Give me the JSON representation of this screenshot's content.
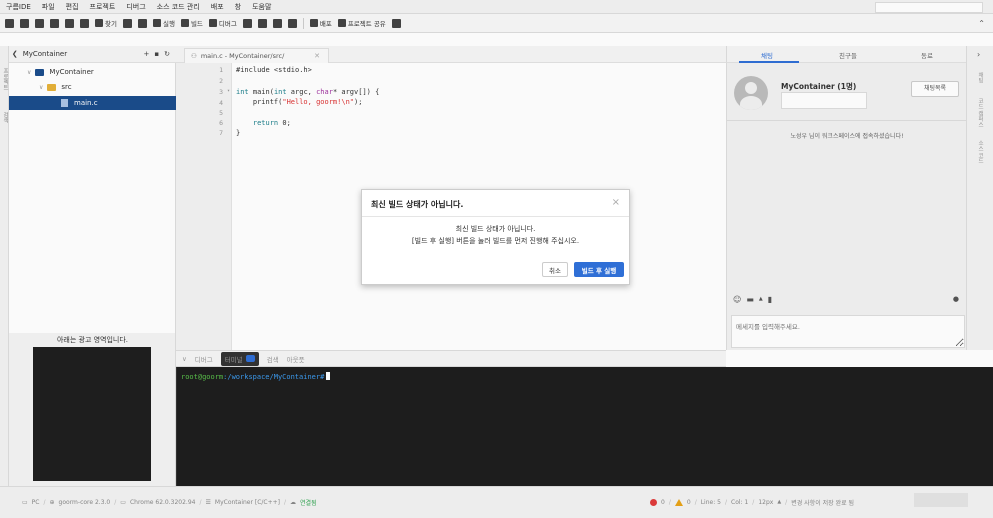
{
  "menubar": {
    "items": [
      "구름IDE",
      "파일",
      "편집",
      "프로젝트",
      "디버그",
      "소스 코드 관리",
      "배포",
      "창",
      "도움말"
    ]
  },
  "toolbar": {
    "find_label": "찾기",
    "run_label": "실행",
    "build_label": "빌드",
    "debug_label": "디버그",
    "deploy_label": "배포",
    "share_label": "프로젝트 공유"
  },
  "left_strip": {
    "labels": [
      "프로젝트",
      "검색"
    ]
  },
  "tree": {
    "header": "MyContainer",
    "items": [
      {
        "label": "MyContainer",
        "kind": "project"
      },
      {
        "label": "src",
        "kind": "folder"
      },
      {
        "label": "main.c",
        "kind": "file",
        "selected": true
      }
    ]
  },
  "ad": {
    "label": "아래는 광고 영역입니다."
  },
  "editor": {
    "tab_label": "main.c - MyContainer/src/",
    "lines": [
      {
        "n": "1",
        "text": "#include <stdio.h>"
      },
      {
        "n": "2",
        "text": ""
      },
      {
        "n": "3",
        "text": "int main(int argc, char* argv[]) {"
      },
      {
        "n": "4",
        "text": "    printf(\"Hello, goorm!\\n\");"
      },
      {
        "n": "5",
        "text": ""
      },
      {
        "n": "6",
        "text": "    return 0;"
      },
      {
        "n": "7",
        "text": "}"
      }
    ],
    "line3": {
      "kw": "int ",
      "fn": "main(",
      "kw2": "int ",
      "mid": "argc, ",
      "ty": "char",
      "rest": "* argv[]) {"
    },
    "line4": {
      "pre": "    printf(",
      "str": "\"Hello, goorm!\\n\"",
      "post": ");"
    },
    "line6": {
      "kw": "    return ",
      "rest": "0;"
    }
  },
  "terminal": {
    "tabs": [
      "디버그",
      "터미널",
      "검색",
      "아웃풋"
    ],
    "active_tab": "터미널",
    "user": "root@goorm",
    "path": ":/workspace/MyContainer#"
  },
  "right_panel": {
    "tabs": [
      "채팅",
      "친구들",
      "동료"
    ],
    "chat_title": "MyContainer (1명)",
    "chat_list_label": "채팅목록",
    "message": "노성우 님이 워크스페이스에 접속하셨습니다!",
    "input_placeholder": "메세지를 입력해주세요."
  },
  "far_right": {
    "labels": [
      "채팅",
      "코드 캠퍼스",
      "소스 코드"
    ]
  },
  "modal": {
    "title": "최신 빌드 상태가 아닙니다.",
    "line1": "최신 빌드 상태가 아닙니다.",
    "line2": "[빌드 후 실행] 버튼을 눌러 빌드를 먼저 진행해 주십시오.",
    "cancel_label": "취소",
    "run_label": "빌드 후 실행",
    "accent": "#2f6fd6"
  },
  "status": {
    "pc": "PC",
    "core": "goorm-core 2.3.0",
    "browser": "Chrome 62.0.3202.94",
    "project": "MyContainer [C/C++]",
    "connected": "연결됨",
    "errors": "0",
    "warnings": "0",
    "line": "Line: 5",
    "col": "Col: 1",
    "font_size": "12px",
    "save_status": "변경 사항이 저장 완료 됨"
  }
}
